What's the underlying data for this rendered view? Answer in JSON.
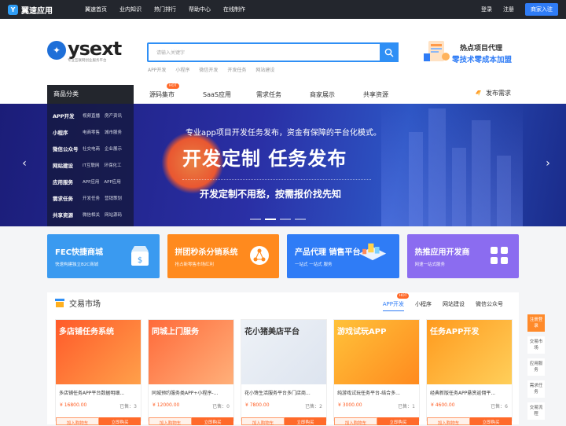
{
  "topbar": {
    "brand": "翼速应用",
    "nav": [
      "翼速首页",
      "业内知识",
      "热门排行",
      "帮助中心",
      "在线制作"
    ],
    "login": "登录",
    "register": "注册",
    "join": "商家入驻"
  },
  "header": {
    "logo_text": "ysext",
    "logo_sub": "专业互联网创业服务平台",
    "search_placeholder": "请输入关键字",
    "hotwords": [
      "APP开发",
      "小程序",
      "微信开发",
      "开发任务",
      "网站建设"
    ],
    "promo_line1": "热点项目代理",
    "promo_line2": "零技术零成本加盟"
  },
  "nav": {
    "category": "商品分类",
    "items": [
      "源码集市",
      "SaaS应用",
      "需求任务",
      "商家展示",
      "共享资源"
    ],
    "hot_badge": "HOT",
    "publish": "发布需求"
  },
  "categories": [
    {
      "name": "APP开发",
      "subs": [
        "视频直播",
        "房产资讯"
      ]
    },
    {
      "name": "小程序",
      "subs": [
        "电商零售",
        "城市服务"
      ]
    },
    {
      "name": "微信公众号",
      "subs": [
        "社交电商",
        "企业展示"
      ]
    },
    {
      "name": "网站建设",
      "subs": [
        "IT互联网",
        "环保化工"
      ]
    },
    {
      "name": "应用服务",
      "subs": [
        "APP应用",
        "APP应用"
      ]
    },
    {
      "name": "需求任务",
      "subs": [
        "开发任务",
        "营销策划"
      ]
    },
    {
      "name": "共享资源",
      "subs": [
        "微信相关",
        "网站源码"
      ]
    }
  ],
  "banner": {
    "line1": "专业app项目开发任务发布，资金有保障的平台化模式。",
    "line2": "开发定制  任务发布",
    "line3": "开发定制不用愁，按需报价找先知",
    "active_slide": 2,
    "slide_count": 4
  },
  "feature_cards": [
    {
      "title": "FEC快捷商城",
      "sub": "快速构建独立B2C商城",
      "color": "#3a9af0",
      "icon": "shop-icon"
    },
    {
      "title": "拼团秒杀分销系统",
      "sub": "抢占新零售市场红利",
      "color": "#ff8a1e",
      "icon": "share-icon"
    },
    {
      "title": "产品代理 销售平台",
      "sub": "一站式 一站式 服务",
      "color": "#2f7cf6",
      "icon": "isometric-icon"
    },
    {
      "title": "热推应用开发商",
      "sub": "网速一站式服务",
      "color": "#8b6cf0",
      "icon": "apps-icon"
    }
  ],
  "market": {
    "title": "交易市场",
    "tabs": [
      "APP开发",
      "小程序",
      "网站建设",
      "微信公众号"
    ],
    "tab_hot": "HOT",
    "products": [
      {
        "img_title": "多店铺任务系统",
        "name": "多店铺任务APP平台数据明细...",
        "price": "¥ 16800.00",
        "sold": "已售：3",
        "bg": "#ff6b2b"
      },
      {
        "img_title": "同城上门服务",
        "name": "同城预约服务类APP+小程序-...",
        "price": "¥ 12000.00",
        "sold": "已售：0",
        "bg": "#ff7a45"
      },
      {
        "img_title": "花小猪美店平台",
        "name": "花小馋生活服务平台多门店商...",
        "price": "¥ 7800.00",
        "sold": "已售：2",
        "bg": "#e9eef5"
      },
      {
        "img_title": "游戏试玩APP",
        "name": "纯游戏试玩任务平台-结合多...",
        "price": "¥ 3000.00",
        "sold": "已售：1",
        "bg": "#ffb020"
      },
      {
        "img_title": "任务APP开发",
        "name": "经典新版任务APP悬赏返佣平...",
        "price": "¥ 4600.00",
        "sold": "已售：6",
        "bg": "#ff8a1e"
      }
    ],
    "cart_label": "加入购物车",
    "buy_label": "立即购买"
  },
  "side": [
    "注册登录",
    "交易市场",
    "应用服务",
    "需求任务",
    "交易流程"
  ]
}
